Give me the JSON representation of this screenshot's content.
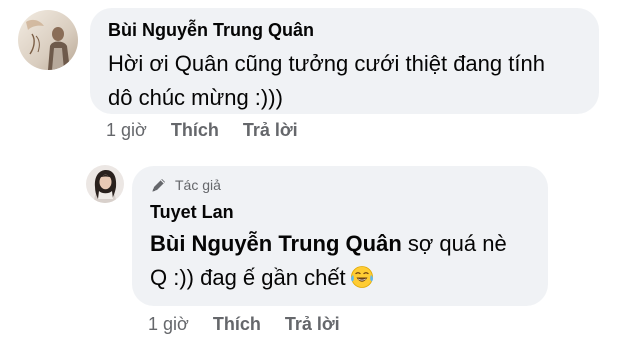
{
  "comment": {
    "author": "Bùi Nguyễn Trung Quân",
    "text_line1": "Hời ơi Quân cũng tưởng cưới thiệt đang tính",
    "text_line2": "dô chúc mừng :)))",
    "time": "1 giờ",
    "like_label": "Thích",
    "reply_label": "Trả lời"
  },
  "reply": {
    "badge_label": "Tác giả",
    "author": "Tuyet Lan",
    "mention": "Bùi Nguyễn Trung Quân",
    "text_line1_rest": " sợ quá nè",
    "text_line2": "Q :)) đag ế gần chết",
    "emoji_icon": "face-with-tears-of-joy",
    "time": "1 giờ",
    "like_label": "Thích",
    "reply_label": "Trả lời"
  },
  "colors": {
    "bubble_background": "#f0f2f5",
    "secondary_text": "#65676b",
    "primary_text": "#050505"
  }
}
